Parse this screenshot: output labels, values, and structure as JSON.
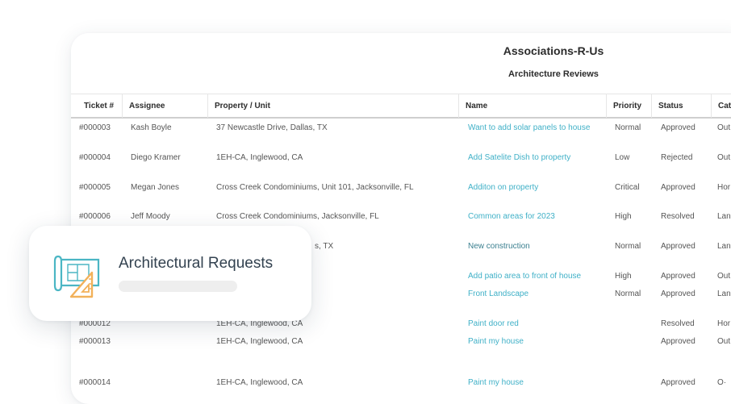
{
  "report": {
    "org_name": "Associations-R-Us",
    "title": "Architecture Reviews",
    "columns": [
      "Ticket #",
      "Assignee",
      "Property / Unit",
      "Name",
      "Priority",
      "Status",
      "Cate"
    ],
    "rows": [
      {
        "ticket": "#000003",
        "assignee": "Kash Boyle",
        "property": "37 Newcastle Drive, Dallas, TX",
        "name": "Want to add solar panels to house",
        "priority": "Normal",
        "status": "Approved",
        "category": "Out"
      },
      {
        "ticket": "#000004",
        "assignee": "Diego Kramer",
        "property": "1EH-CA, Inglewood, CA",
        "name": "Add Satelite Dish to property",
        "priority": "Low",
        "status": "Rejected",
        "category": "Out"
      },
      {
        "ticket": "#000005",
        "assignee": "Megan Jones",
        "property": "Cross Creek Condominiums, Unit 101, Jacksonville, FL",
        "name": "Additon on property",
        "priority": "Critical",
        "status": "Approved",
        "category": "Hor"
      },
      {
        "ticket": "#000006",
        "assignee": "Jeff Moody",
        "property": "Cross Creek Condominiums, Jacksonville, FL",
        "name": "Common areas for 2023",
        "priority": "High",
        "status": "Resolved",
        "category": "Lan"
      },
      {
        "ticket": "",
        "assignee": "",
        "property": "s, TX",
        "name": "New construction",
        "priority": "Normal",
        "status": "Approved",
        "category": "Lan"
      },
      {
        "ticket": "",
        "assignee": "",
        "property": "",
        "name": "Add patio area to front of house",
        "priority": "High",
        "status": "Approved",
        "category": "Out"
      },
      {
        "ticket": "",
        "assignee": "",
        "property": "",
        "name": "Front Landscape",
        "priority": "Normal",
        "status": "Approved",
        "category": "Lan"
      },
      {
        "ticket": "#000012",
        "assignee": "",
        "property": "1EH-CA, Inglewood, CA",
        "name": "Paint door red",
        "priority": "",
        "status": "Resolved",
        "category": "Hor"
      },
      {
        "ticket": "#000013",
        "assignee": "",
        "property": "1EH-CA, Inglewood, CA",
        "name": "Paint my house",
        "priority": "",
        "status": "Approved",
        "category": "Out"
      },
      {
        "ticket": "#000014",
        "assignee": "",
        "property": "1EH-CA, Inglewood, CA",
        "name": "Paint my house",
        "priority": "",
        "status": "Approved",
        "category": "O·"
      }
    ]
  },
  "overlay": {
    "title": "Architectural Requests",
    "icon": "blueprint-ruler-icon"
  },
  "colors": {
    "link": "#3fb0c7",
    "link_dark": "#3a7f8f",
    "icon_teal": "#4bb6c4",
    "icon_orange": "#f2b15a",
    "title_text": "#334250"
  }
}
